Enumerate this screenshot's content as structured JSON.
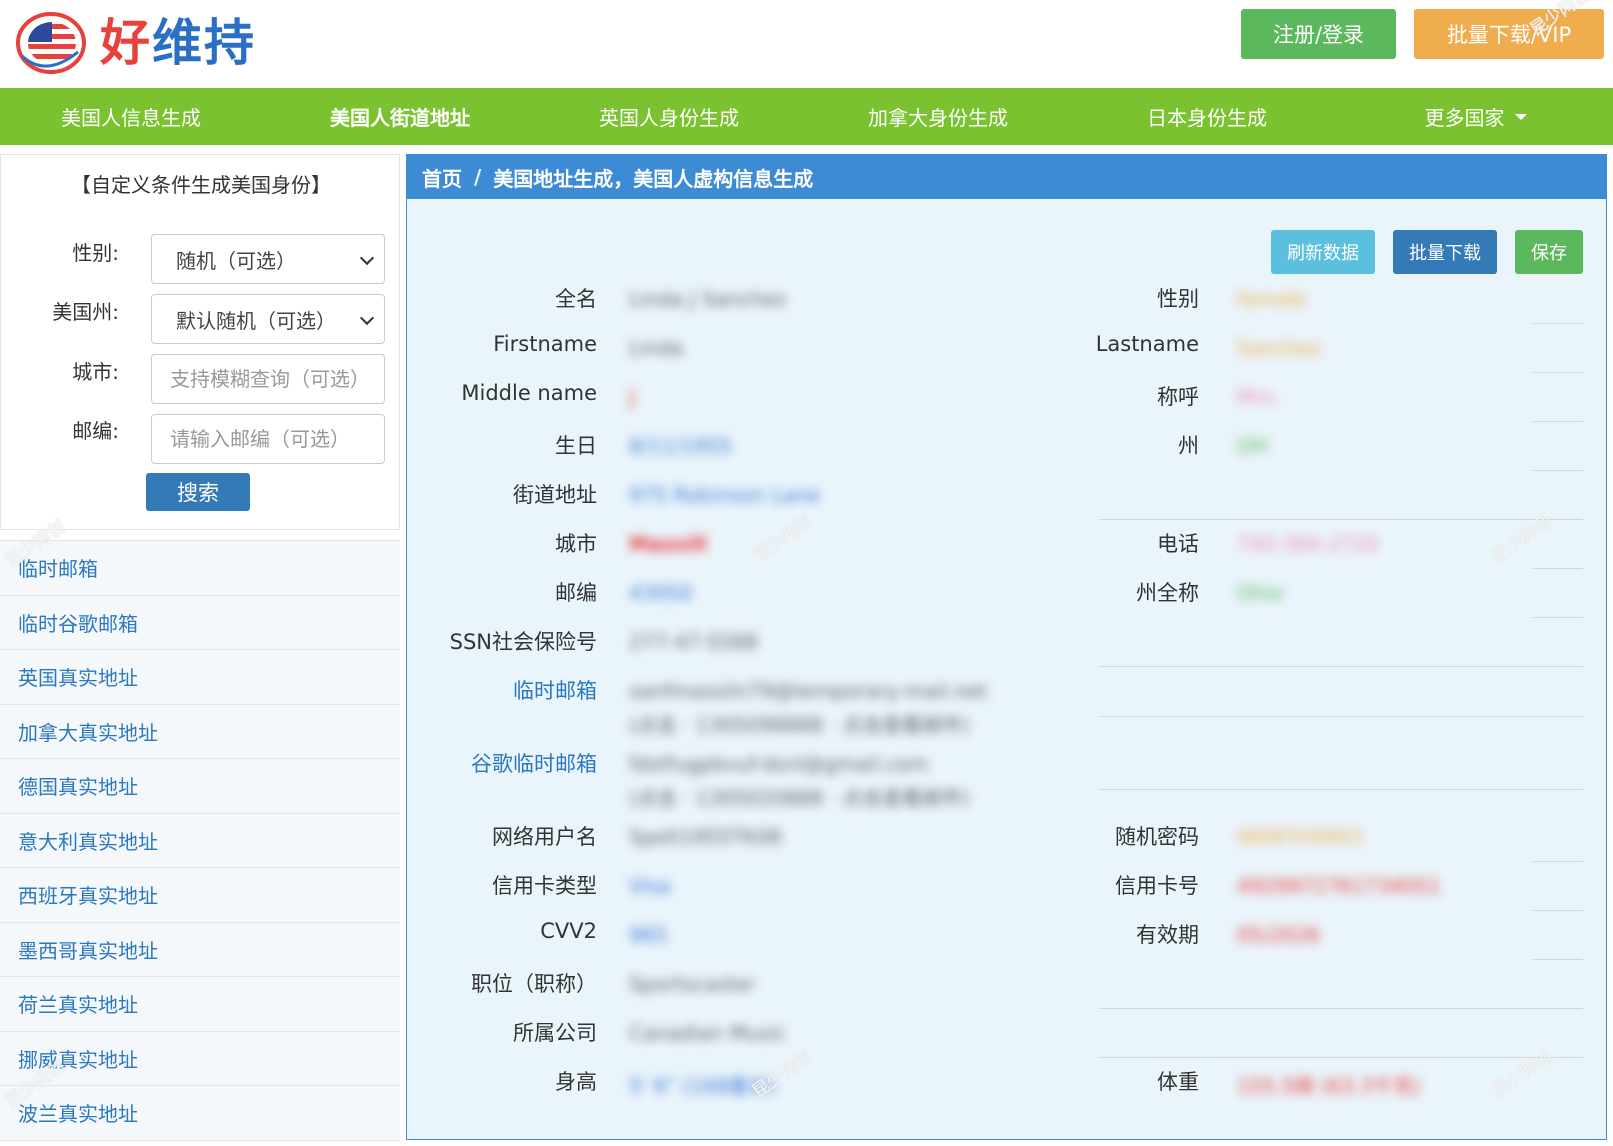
{
  "header": {
    "logo_text_part1": "好",
    "logo_text_part2": "维持",
    "login_button": "注册/登录",
    "vip_button": "批量下载/VIP"
  },
  "nav": {
    "items": [
      {
        "label": "美国人信息生成"
      },
      {
        "label": "美国人街道地址"
      },
      {
        "label": "英国人身份生成"
      },
      {
        "label": "加拿大身份生成"
      },
      {
        "label": "日本身份生成"
      },
      {
        "label": "更多国家"
      }
    ]
  },
  "search": {
    "title": "【自定义条件生成美国身份】",
    "gender_label": "性别:",
    "gender_value": "随机（可选）",
    "state_label": "美国州:",
    "state_value": "默认随机（可选）",
    "city_label": "城市:",
    "city_placeholder": "支持模糊查询（可选）",
    "zip_label": "邮编:",
    "zip_placeholder": "请输入邮编（可选）",
    "search_button": "搜索"
  },
  "sidebar_links": [
    "临时邮箱",
    "临时谷歌邮箱",
    "英国真实地址",
    "加拿大真实地址",
    "德国真实地址",
    "意大利真实地址",
    "西班牙真实地址",
    "墨西哥真实地址",
    "荷兰真实地址",
    "挪威真实地址",
    "波兰真实地址"
  ],
  "breadcrumb": {
    "home": "首页",
    "separator": "/",
    "current": "美国地址生成，美国人虚构信息生成"
  },
  "actions": {
    "refresh": "刷新数据",
    "batch": "批量下载",
    "save": "保存"
  },
  "fields": {
    "fullname": {
      "label": "全名",
      "value": "Linda J Sanchez"
    },
    "gender": {
      "label": "性别",
      "value": "female"
    },
    "firstname": {
      "label": "Firstname",
      "value": "Linda"
    },
    "lastname": {
      "label": "Lastname",
      "value": "Sanchez"
    },
    "middlename": {
      "label": "Middle name",
      "value": "J"
    },
    "title": {
      "label": "称呼",
      "value": "Mrs."
    },
    "birthday": {
      "label": "生日",
      "value": "8/11/1955"
    },
    "state": {
      "label": "州",
      "value": "OH"
    },
    "street": {
      "label": "街道地址",
      "value": "975 Robinson Lane"
    },
    "city": {
      "label": "城市",
      "value": "Massill"
    },
    "phone": {
      "label": "电话",
      "value": "740-384-2720"
    },
    "zip": {
      "label": "邮编",
      "value": "43050"
    },
    "state_full": {
      "label": "州全称",
      "value": "Ohio"
    },
    "ssn": {
      "label": "SSN社会保险号",
      "value": "277-47-5588"
    },
    "temp_email": {
      "label": "临时邮箱",
      "value": "sanfmassiln79@temporary-mail.net",
      "value2": "(点击 · 1305098888 · 点击查看邮件)"
    },
    "google_email": {
      "label": "谷歌临时邮箱",
      "value": "fdstfugpbvuf-dsnl@gmail.com",
      "value2": "(点击 · 1305020888 · 点击查看邮件)"
    },
    "username": {
      "label": "网络用户名",
      "value": "Spelt1955TK08"
    },
    "password": {
      "label": "随机密码",
      "value": "WEBTH5R63"
    },
    "card_type": {
      "label": "信用卡类型",
      "value": "Visa"
    },
    "card_number": {
      "label": "信用卡号",
      "value": "4929972761734051"
    },
    "cvv": {
      "label": "CVV2",
      "value": "965"
    },
    "expiry": {
      "label": "有效期",
      "value": "05/2026"
    },
    "job": {
      "label": "职位（职称）",
      "value": "Sportscaster"
    },
    "company": {
      "label": "所属公司",
      "value": "Canadian Music"
    },
    "height": {
      "label": "身高",
      "value": "5' 6\"  (168厘米)"
    },
    "weight": {
      "label": "体重",
      "value": "155.5磅 (63.3千克)"
    }
  },
  "watermark": "昆少网创",
  "colors": {
    "nav_green": "#7ac22f",
    "panel_blue": "#3d8bd4",
    "panel_bg": "#eaf4fb",
    "btn_green": "#5cb85c",
    "btn_orange": "#f0ad4e",
    "btn_info": "#5bc0de",
    "btn_primary": "#337ab7",
    "link_blue": "#2b78bf"
  }
}
